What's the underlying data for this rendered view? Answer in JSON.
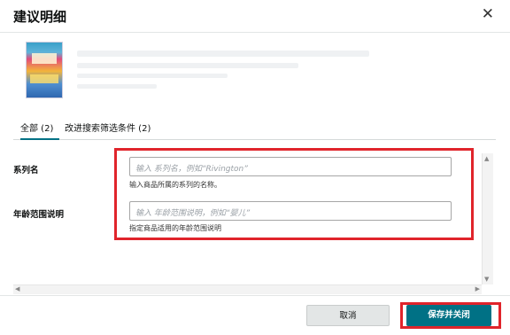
{
  "dialog": {
    "title": "建议明细",
    "close_glyph": "✕"
  },
  "tabs": [
    {
      "label": "全部 (2)"
    },
    {
      "label": "改进搜索筛选条件 (2)"
    }
  ],
  "fields": [
    {
      "label": "系列名",
      "placeholder": "输入 系列名，例如“Rivington”",
      "help": "输入商品所属的系列的名称。"
    },
    {
      "label": "年龄范围说明",
      "placeholder": "输入 年龄范围说明，例如“婴儿”",
      "help": "指定商品适用的年龄范围说明"
    }
  ],
  "footer": {
    "cancel_label": "取消",
    "save_label": "保存并关闭"
  },
  "colors": {
    "accent": "#007185",
    "highlight": "#e0242b"
  }
}
